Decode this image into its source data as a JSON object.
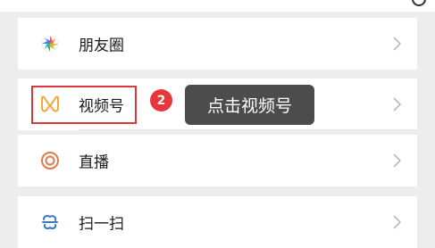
{
  "menu": {
    "items": [
      {
        "label": "朋友圈",
        "icon": "moments-aperture-icon"
      },
      {
        "label": "视频号",
        "icon": "channels-icon"
      },
      {
        "label": "直播",
        "icon": "live-icon"
      },
      {
        "label": "扫一扫",
        "icon": "scan-icon"
      }
    ]
  },
  "annotation": {
    "step_number": "2",
    "tooltip_text": "点击视频号",
    "highlight_color": "#d9383f",
    "badge_color": "#e8373a"
  },
  "colors": {
    "background": "#ededed",
    "row": "#ffffff",
    "channels_icon": "#f0a93b",
    "live_icon": "#e07a4a",
    "scan_icon": "#3b7ac7"
  }
}
